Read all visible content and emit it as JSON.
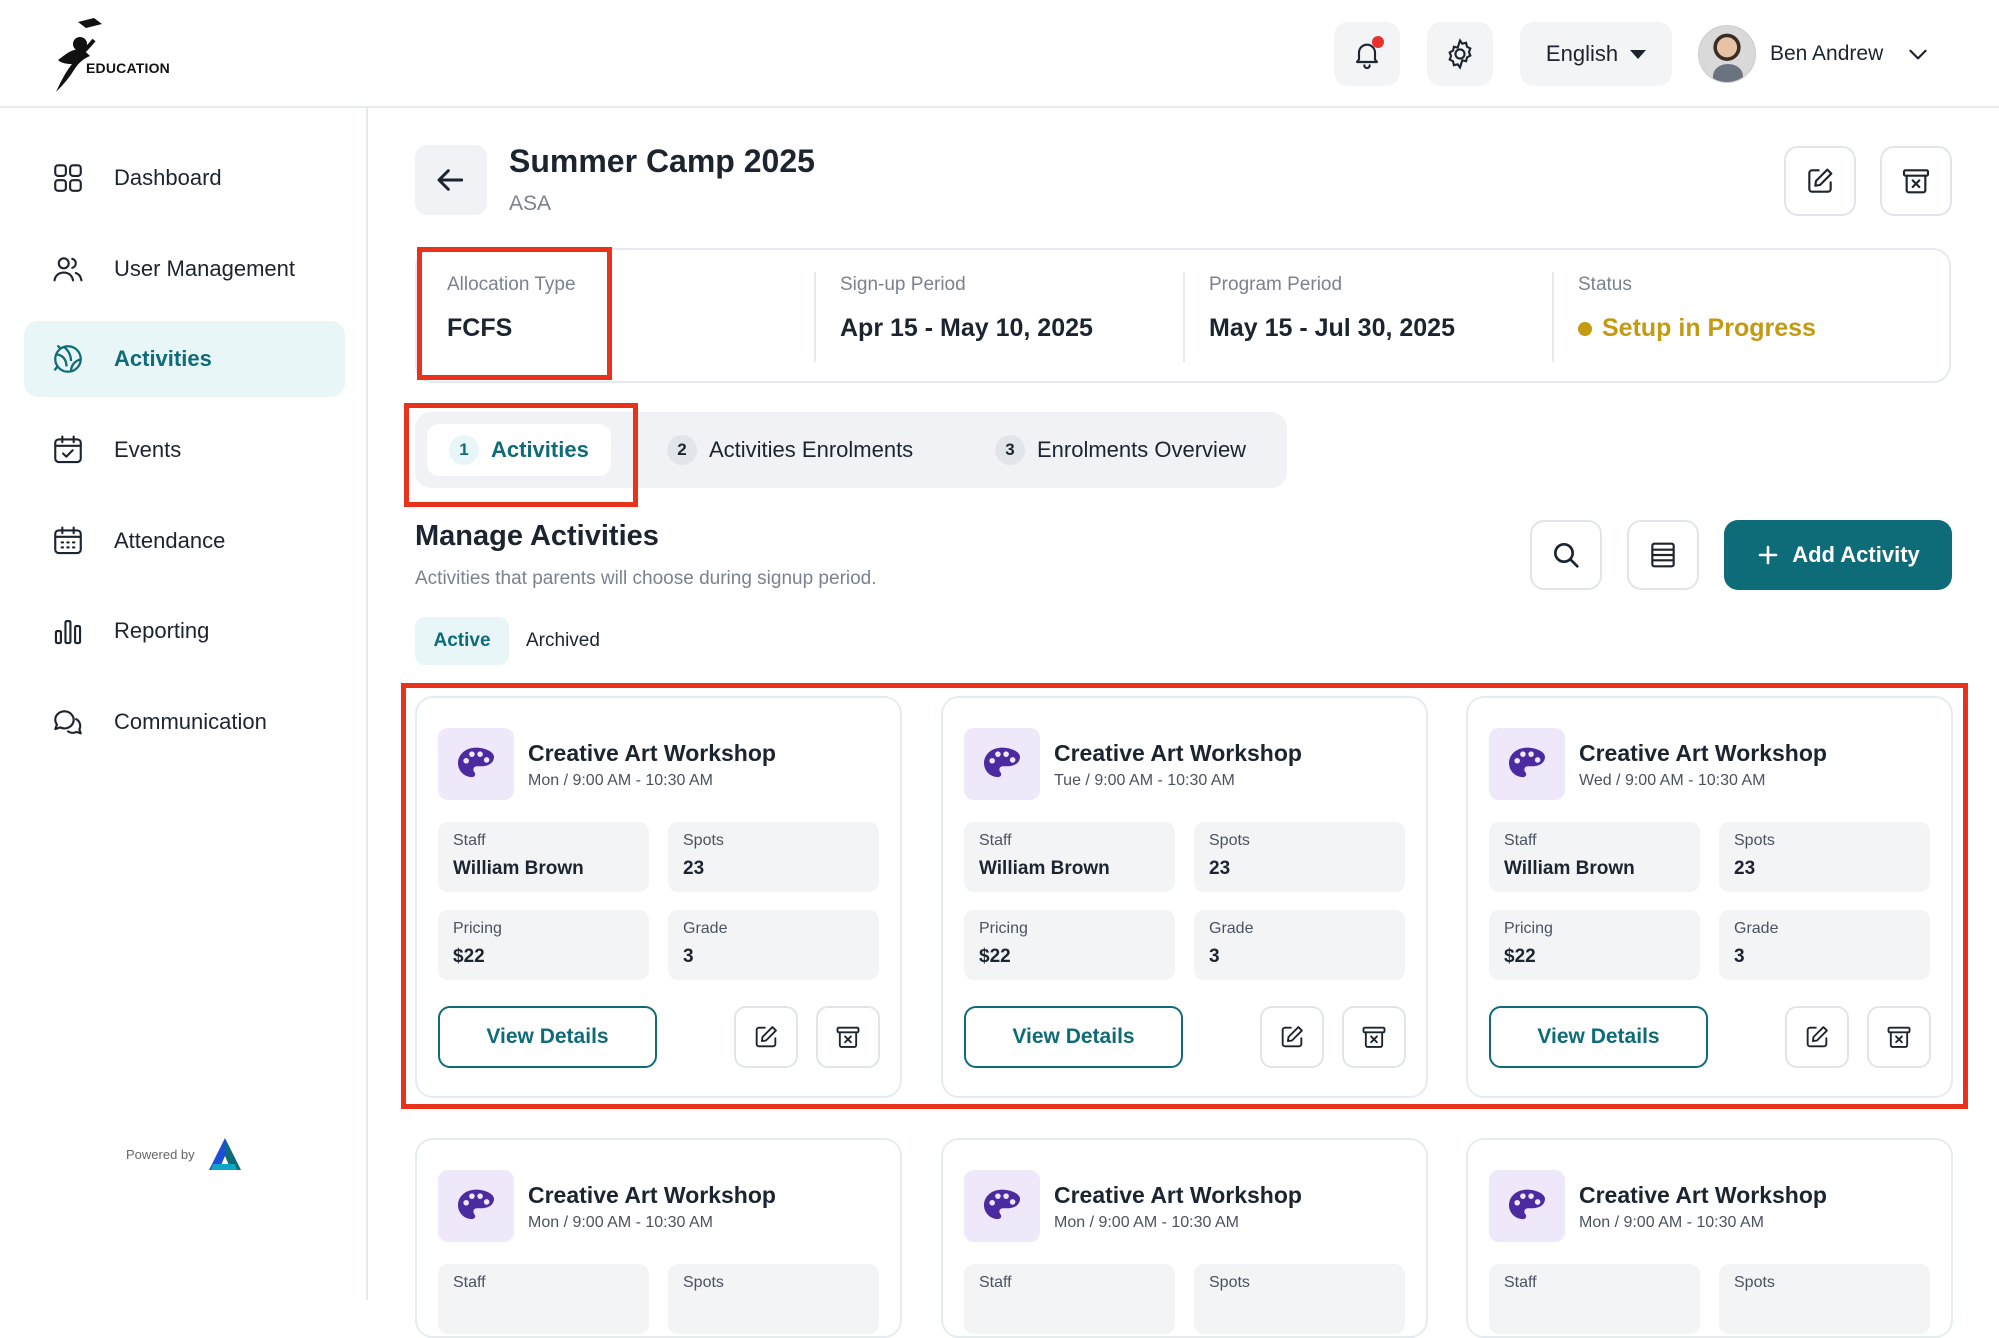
{
  "brand": {
    "logo_text": "EDUCATION",
    "powered_by": "Powered by"
  },
  "header": {
    "language": "English",
    "user_name": "Ben Andrew",
    "has_notification": true
  },
  "sidebar": {
    "items": [
      {
        "label": "Dashboard",
        "icon": "dashboard-icon",
        "active": false
      },
      {
        "label": "User Management",
        "icon": "users-icon",
        "active": false
      },
      {
        "label": "Activities",
        "icon": "activities-icon",
        "active": true
      },
      {
        "label": "Events",
        "icon": "calendar-check-icon",
        "active": false
      },
      {
        "label": "Attendance",
        "icon": "calendar-grid-icon",
        "active": false
      },
      {
        "label": "Reporting",
        "icon": "bar-chart-icon",
        "active": false
      },
      {
        "label": "Communication",
        "icon": "chat-icon",
        "active": false
      }
    ]
  },
  "program": {
    "title": "Summer Camp 2025",
    "subtitle": "ASA",
    "info": [
      {
        "label": "Allocation Type",
        "value": "FCFS"
      },
      {
        "label": "Sign-up Period",
        "value": "Apr 15 - May 10, 2025"
      },
      {
        "label": "Program Period",
        "value": "May 15 - Jul 30, 2025"
      },
      {
        "label": "Status",
        "value": "Setup in Progress"
      }
    ]
  },
  "steps": [
    {
      "num": "1",
      "label": "Activities",
      "active": true
    },
    {
      "num": "2",
      "label": "Activities Enrolments",
      "active": false
    },
    {
      "num": "3",
      "label": "Enrolments Overview",
      "active": false
    }
  ],
  "manage": {
    "title": "Manage Activities",
    "subtitle": "Activities that parents will choose during signup period.",
    "add_label": "Add Activity",
    "filter_active": "Active",
    "filter_archived": "Archived"
  },
  "cards": [
    {
      "title": "Creative Art Workshop",
      "time": "Mon / 9:00 AM - 10:30 AM",
      "staff_label": "Staff",
      "staff": "William Brown",
      "spots_label": "Spots",
      "spots": "23",
      "pricing_label": "Pricing",
      "pricing": "$22",
      "grade_label": "Grade",
      "grade": "3",
      "view_label": "View Details"
    },
    {
      "title": "Creative Art Workshop",
      "time": "Tue / 9:00 AM - 10:30 AM",
      "staff_label": "Staff",
      "staff": "William Brown",
      "spots_label": "Spots",
      "spots": "23",
      "pricing_label": "Pricing",
      "pricing": "$22",
      "grade_label": "Grade",
      "grade": "3",
      "view_label": "View Details"
    },
    {
      "title": "Creative Art Workshop",
      "time": "Wed / 9:00 AM - 10:30 AM",
      "staff_label": "Staff",
      "staff": "William Brown",
      "spots_label": "Spots",
      "spots": "23",
      "pricing_label": "Pricing",
      "pricing": "$22",
      "grade_label": "Grade",
      "grade": "3",
      "view_label": "View Details"
    },
    {
      "title": "Creative Art Workshop",
      "time": "Mon / 9:00 AM - 10:30 AM",
      "staff_label": "Staff",
      "spots_label": "Spots"
    },
    {
      "title": "Creative Art Workshop",
      "time": "Mon / 9:00 AM - 10:30 AM",
      "staff_label": "Staff",
      "spots_label": "Spots"
    },
    {
      "title": "Creative Art Workshop",
      "time": "Mon / 9:00 AM - 10:30 AM",
      "staff_label": "Staff",
      "spots_label": "Spots"
    }
  ],
  "colors": {
    "accent": "#0e6b78",
    "status": "#c49a12",
    "highlight": "#e8321c",
    "notification": "#e8302c"
  }
}
